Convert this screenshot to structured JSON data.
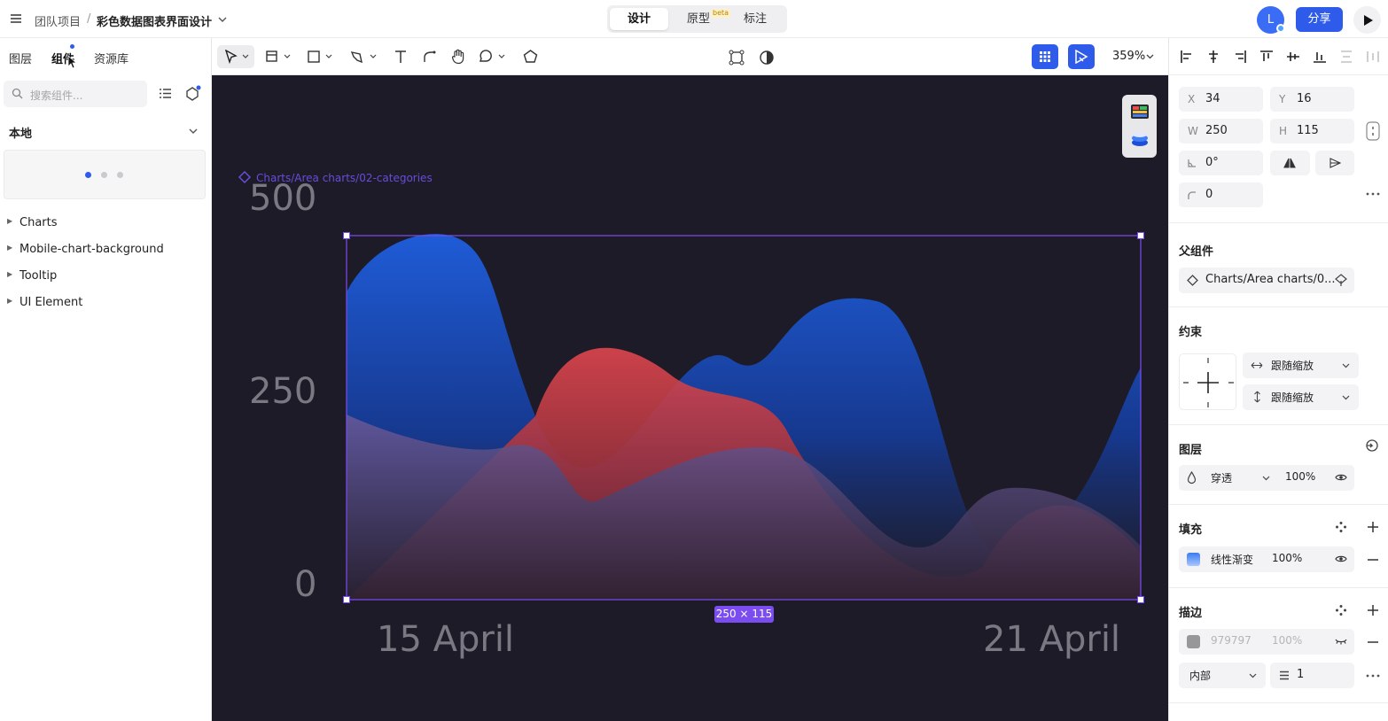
{
  "topbar": {
    "project": "团队项目",
    "separator": "/",
    "file_name": "彩色数据图表界面设计",
    "modes": [
      "设计",
      "原型",
      "标注"
    ],
    "active_mode": "设计",
    "beta_badge": "beta",
    "avatar_letter": "L",
    "share_label": "分享"
  },
  "left_panel": {
    "tabs": [
      "图层",
      "组件",
      "资源库"
    ],
    "active_tab": "组件",
    "search_placeholder": "搜索组件...",
    "section_title": "本地",
    "tree": [
      "Charts",
      "Mobile-chart-background",
      "Tooltip",
      "UI Element"
    ]
  },
  "toolbar": {
    "zoom": "359%"
  },
  "canvas": {
    "component_label": "Charts/Area charts/02-categories",
    "size_badge": "250 × 115",
    "accent": "#7b4cf0",
    "background": "#1d1b27"
  },
  "chart_data": {
    "type": "area",
    "y_ticks": [
      "500",
      "250",
      "0"
    ],
    "x_ticks": [
      "15 April",
      "21 April"
    ],
    "series": [
      {
        "color": "#1f5fe0"
      },
      {
        "color": "#e0464e"
      },
      {
        "color": "#6a5a9a"
      }
    ]
  },
  "right_panel": {
    "x": {
      "label": "X",
      "value": "34"
    },
    "y": {
      "label": "Y",
      "value": "16"
    },
    "w": {
      "label": "W",
      "value": "250"
    },
    "h": {
      "label": "H",
      "value": "115"
    },
    "rotation": "0°",
    "radius": "0",
    "parent_title": "父组件",
    "parent_name": "Charts/Area charts/0...",
    "constraints_title": "约束",
    "constraint_h": "跟随缩放",
    "constraint_v": "跟随缩放",
    "layer_title": "图层",
    "blend_mode": "穿透",
    "layer_opacity": "100%",
    "fill_title": "填充",
    "fill_type": "线性渐变",
    "fill_opacity": "100%",
    "stroke_title": "描边",
    "stroke_color": "979797",
    "stroke_opacity": "100%",
    "stroke_position": "内部",
    "stroke_width": "1"
  }
}
